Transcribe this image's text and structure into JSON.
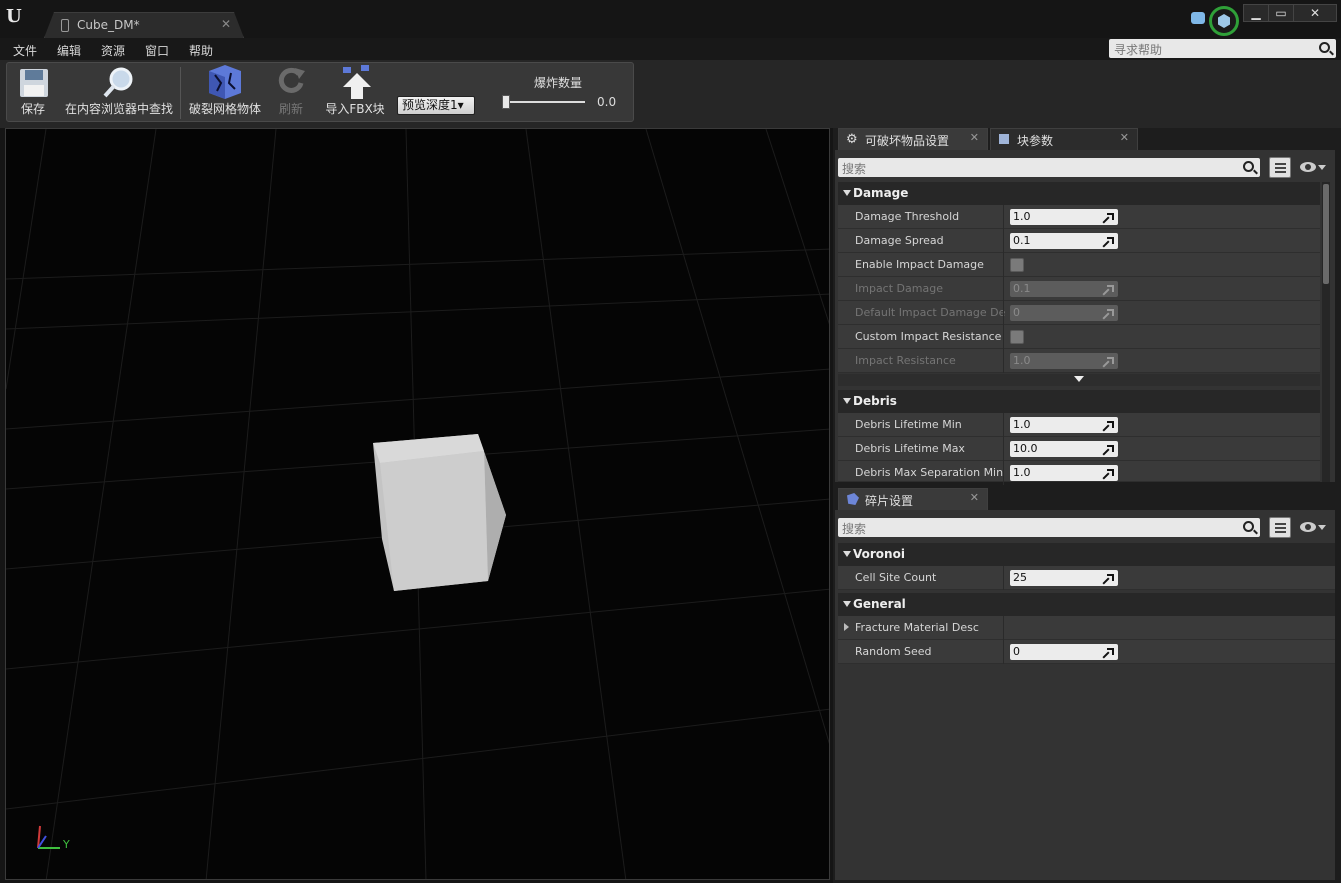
{
  "app": {
    "logo_text": "U",
    "document_tab": "Cube_DM*",
    "window_buttons": [
      "▁",
      "▭",
      "✕"
    ]
  },
  "menu": {
    "items": [
      "文件",
      "编辑",
      "资源",
      "窗口",
      "帮助"
    ],
    "help_search_placeholder": "寻求帮助"
  },
  "toolbar": {
    "save_label": "保存",
    "find_in_browser_label": "在内容浏览器中查找",
    "fracture_label": "破裂网格物体",
    "refresh_label": "刷新",
    "import_fbx_label": "导入FBX块",
    "preview_depth_value": "预览深度1▾",
    "explode_label": "爆炸数量",
    "explode_value": "0.0",
    "explode_amount": 0.0
  },
  "viewport": {
    "axis_y_label": "Y"
  },
  "destructible_panel": {
    "tabs": [
      {
        "label": "可破坏物品设置",
        "close": "✕"
      },
      {
        "label": "块参数",
        "close": "✕"
      }
    ],
    "search_placeholder": "搜索",
    "categories": {
      "damage": {
        "title": "Damage",
        "rows": [
          {
            "name": "Damage Threshold",
            "value": "1.0"
          },
          {
            "name": "Damage Spread",
            "value": "0.1"
          },
          {
            "name": "Enable Impact Damage",
            "checked": false
          },
          {
            "name": "Impact Damage",
            "value": "0.1",
            "disabled": true
          },
          {
            "name": "Default Impact Damage Depth",
            "value": "0",
            "disabled": true
          },
          {
            "name": "Custom Impact Resistance",
            "checked": false
          },
          {
            "name": "Impact Resistance",
            "value": "1.0",
            "disabled": true
          }
        ]
      },
      "debris": {
        "title": "Debris",
        "rows": [
          {
            "name": "Debris Lifetime Min",
            "value": "1.0"
          },
          {
            "name": "Debris Lifetime Max",
            "value": "10.0"
          },
          {
            "name": "Debris Max Separation Min",
            "value": "1.0"
          }
        ]
      }
    }
  },
  "fracture_panel": {
    "tab": {
      "label": "碎片设置",
      "close": "✕"
    },
    "search_placeholder": "搜索",
    "categories": {
      "voronoi": {
        "title": "Voronoi",
        "rows": [
          {
            "name": "Cell Site Count",
            "value": "25"
          }
        ]
      },
      "general": {
        "title": "General",
        "rows": [
          {
            "name": "Fracture Material Desc"
          },
          {
            "name": "Random Seed",
            "value": "0"
          }
        ]
      }
    }
  },
  "colors": {
    "background": "#151515",
    "panel": "#333333",
    "property_row": "#3a3a3a",
    "source_control_ring": "#2fa038"
  }
}
